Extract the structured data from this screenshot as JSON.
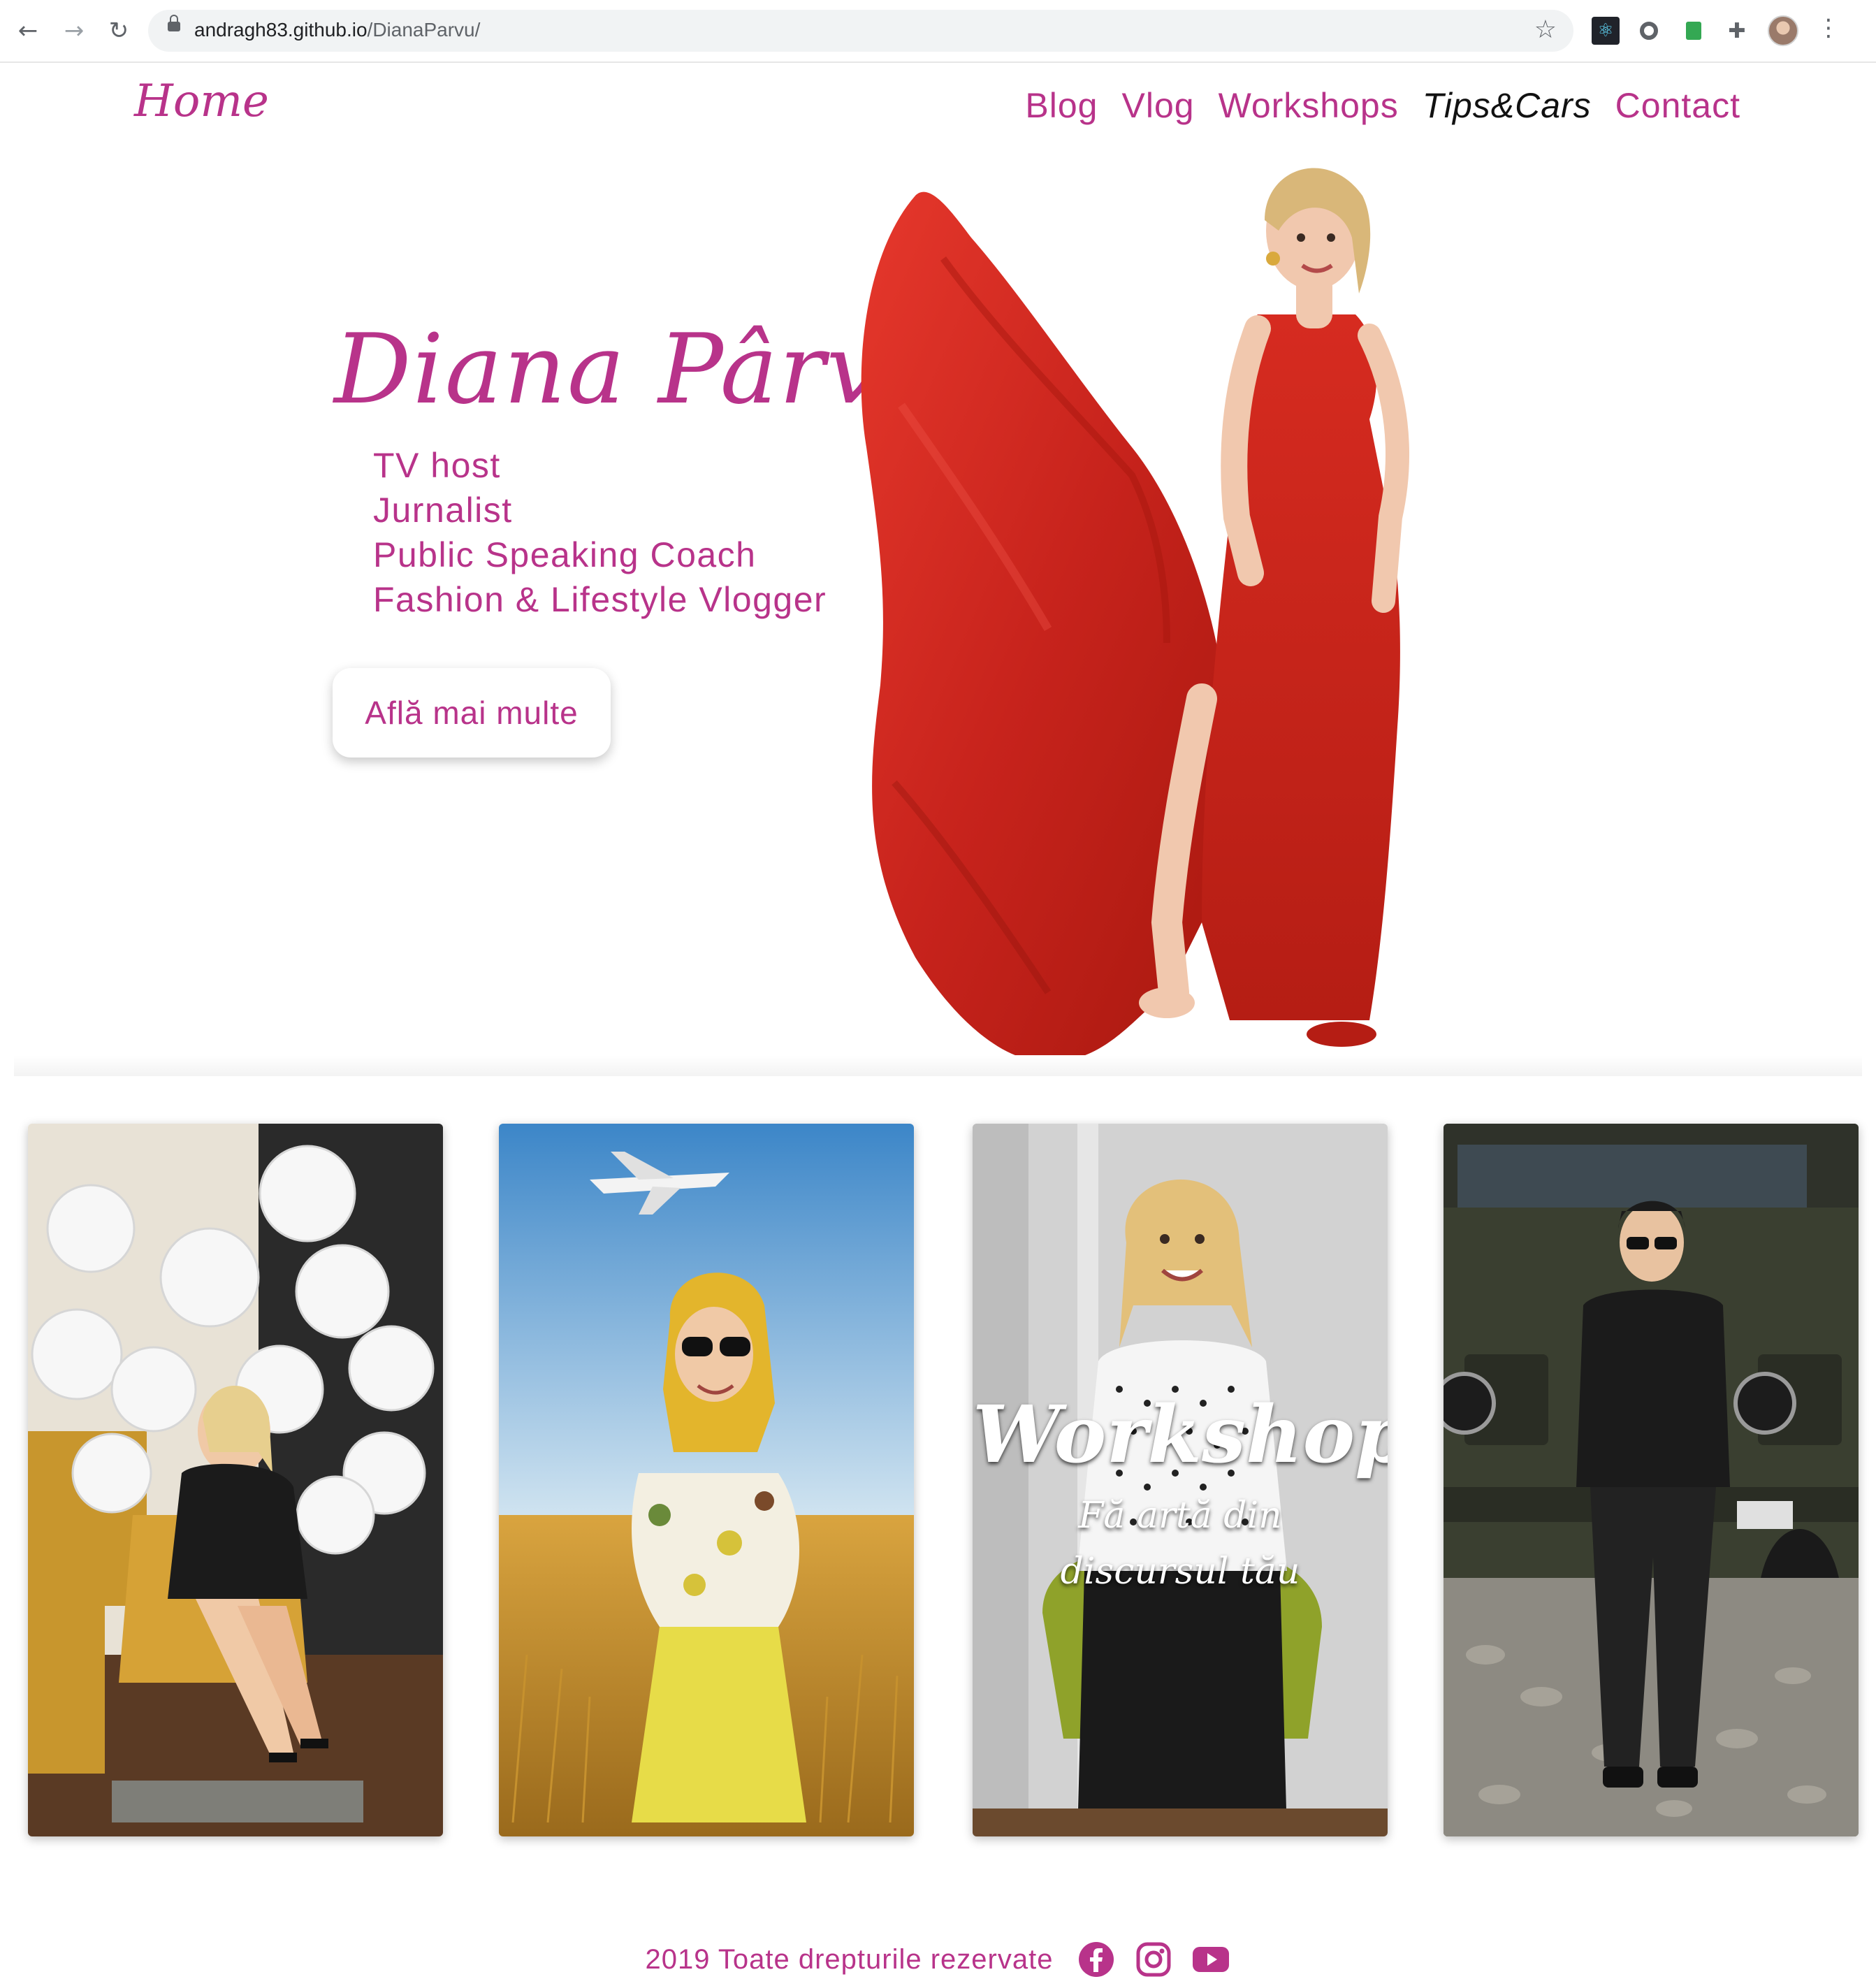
{
  "browser": {
    "url_host": "andragh83.github.io",
    "url_path": "/DianaParvu/"
  },
  "site": {
    "home_label": "Home",
    "nav": [
      {
        "label": "Blog"
      },
      {
        "label": "Vlog"
      },
      {
        "label": "Workshops"
      },
      {
        "label": "Tips&Cars",
        "active": true
      },
      {
        "label": "Contact"
      }
    ]
  },
  "hero": {
    "name": "Diana Pârvu",
    "roles": [
      "TV host",
      "Jurnalist",
      "Public Speaking Coach",
      "Fashion & Lifestyle Vlogger"
    ],
    "cta_label": "Află mai multe"
  },
  "cards": [
    {
      "title": "",
      "subtitle": ""
    },
    {
      "title": "",
      "subtitle": ""
    },
    {
      "title": "Workshops",
      "subtitle": "Fă artă din discursul tău"
    },
    {
      "title": "",
      "subtitle": ""
    }
  ],
  "footer": {
    "text": "2019 Toate drepturile rezervate",
    "social": [
      "facebook-icon",
      "instagram-icon",
      "youtube-icon"
    ]
  },
  "colors": {
    "brand": "#b8338a",
    "dress": "#d42a22"
  }
}
